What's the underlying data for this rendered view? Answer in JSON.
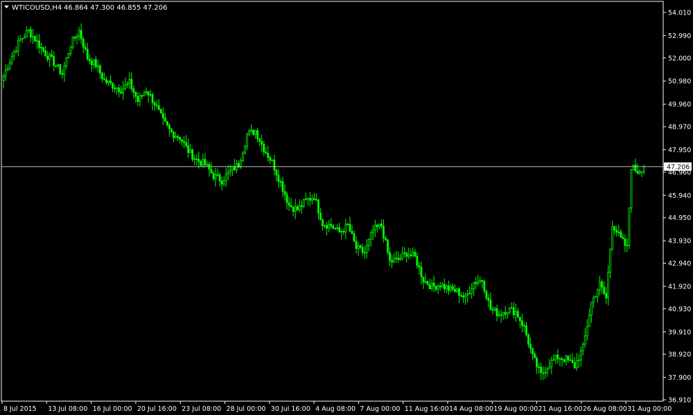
{
  "header": {
    "symbol_label": "WTICOUSD,H4",
    "quote": "46.864 47.300 46.855 47.206"
  },
  "colors": {
    "background": "#000000",
    "frame": "#ffffff",
    "candle": "#00ff00",
    "bid_line": "#c0c0c0",
    "price_tag_bg": "#ffffff",
    "text": "#ffffff"
  },
  "chart_data": {
    "type": "candlestick",
    "symbol": "WTICOUSD",
    "timeframe": "H4",
    "ohlc_last": {
      "open": 46.864,
      "high": 47.3,
      "low": 46.855,
      "close": 47.206
    },
    "current_price": "47.206",
    "y_ticks": [
      "54.010",
      "52.990",
      "52.000",
      "50.980",
      "49.960",
      "48.970",
      "47.950",
      "46.960",
      "45.940",
      "44.950",
      "43.930",
      "42.940",
      "41.920",
      "40.930",
      "39.910",
      "38.920",
      "37.900",
      "36.910"
    ],
    "ylim": [
      36.7,
      54.4
    ],
    "x_ticks": [
      "8 Jul 2015",
      "13 Jul 08:00",
      "16 Jul 00:00",
      "20 Jul 16:00",
      "23 Jul 08:00",
      "28 Jul 00:00",
      "30 Jul 16:00",
      "4 Aug 08:00",
      "7 Aug 00:00",
      "11 Aug 16:00",
      "14 Aug 08:00",
      "19 Aug 00:00",
      "21 Aug 16:00",
      "26 Aug 08:00",
      "31 Aug 00:00"
    ],
    "anchors": [
      {
        "i": 0,
        "c": 51.2
      },
      {
        "i": 4,
        "c": 52.1
      },
      {
        "i": 8,
        "c": 52.8
      },
      {
        "i": 12,
        "c": 53.2
      },
      {
        "i": 16,
        "c": 52.7
      },
      {
        "i": 20,
        "c": 52.2
      },
      {
        "i": 24,
        "c": 51.8
      },
      {
        "i": 28,
        "c": 51.3
      },
      {
        "i": 32,
        "c": 52.6
      },
      {
        "i": 36,
        "c": 53.2
      },
      {
        "i": 40,
        "c": 52.0
      },
      {
        "i": 44,
        "c": 51.7
      },
      {
        "i": 48,
        "c": 51.0
      },
      {
        "i": 52,
        "c": 50.8
      },
      {
        "i": 56,
        "c": 50.6
      },
      {
        "i": 60,
        "c": 50.9
      },
      {
        "i": 64,
        "c": 50.1
      },
      {
        "i": 68,
        "c": 50.6
      },
      {
        "i": 72,
        "c": 50.0
      },
      {
        "i": 76,
        "c": 49.2
      },
      {
        "i": 80,
        "c": 48.7
      },
      {
        "i": 84,
        "c": 48.5
      },
      {
        "i": 88,
        "c": 47.9
      },
      {
        "i": 92,
        "c": 47.5
      },
      {
        "i": 96,
        "c": 47.3
      },
      {
        "i": 100,
        "c": 46.8
      },
      {
        "i": 104,
        "c": 46.6
      },
      {
        "i": 108,
        "c": 47.0
      },
      {
        "i": 112,
        "c": 47.3
      },
      {
        "i": 116,
        "c": 48.6
      },
      {
        "i": 120,
        "c": 48.8
      },
      {
        "i": 124,
        "c": 48.0
      },
      {
        "i": 128,
        "c": 47.4
      },
      {
        "i": 132,
        "c": 46.5
      },
      {
        "i": 136,
        "c": 45.5
      },
      {
        "i": 140,
        "c": 45.3
      },
      {
        "i": 144,
        "c": 45.7
      },
      {
        "i": 148,
        "c": 45.9
      },
      {
        "i": 152,
        "c": 44.7
      },
      {
        "i": 156,
        "c": 44.6
      },
      {
        "i": 160,
        "c": 44.3
      },
      {
        "i": 164,
        "c": 44.6
      },
      {
        "i": 168,
        "c": 43.6
      },
      {
        "i": 172,
        "c": 43.4
      },
      {
        "i": 176,
        "c": 44.4
      },
      {
        "i": 180,
        "c": 44.6
      },
      {
        "i": 184,
        "c": 43.0
      },
      {
        "i": 188,
        "c": 43.1
      },
      {
        "i": 192,
        "c": 43.4
      },
      {
        "i": 196,
        "c": 43.2
      },
      {
        "i": 200,
        "c": 42.2
      },
      {
        "i": 204,
        "c": 41.9
      },
      {
        "i": 208,
        "c": 42.0
      },
      {
        "i": 212,
        "c": 41.8
      },
      {
        "i": 216,
        "c": 41.7
      },
      {
        "i": 220,
        "c": 41.4
      },
      {
        "i": 224,
        "c": 42.1
      },
      {
        "i": 228,
        "c": 42.2
      },
      {
        "i": 232,
        "c": 40.9
      },
      {
        "i": 236,
        "c": 40.7
      },
      {
        "i": 240,
        "c": 40.9
      },
      {
        "i": 244,
        "c": 40.8
      },
      {
        "i": 248,
        "c": 40.1
      },
      {
        "i": 252,
        "c": 38.8
      },
      {
        "i": 256,
        "c": 38.0
      },
      {
        "i": 260,
        "c": 38.5
      },
      {
        "i": 264,
        "c": 38.8
      },
      {
        "i": 268,
        "c": 38.7
      },
      {
        "i": 272,
        "c": 38.4
      },
      {
        "i": 276,
        "c": 39.2
      },
      {
        "i": 280,
        "c": 41.2
      },
      {
        "i": 284,
        "c": 42.0
      },
      {
        "i": 287,
        "c": 41.4
      },
      {
        "i": 290,
        "c": 44.7
      },
      {
        "i": 294,
        "c": 44.0
      },
      {
        "i": 297,
        "c": 43.6
      },
      {
        "i": 299,
        "c": 47.2
      },
      {
        "i": 302,
        "c": 47.0
      },
      {
        "i": 305,
        "c": 47.206
      }
    ]
  }
}
